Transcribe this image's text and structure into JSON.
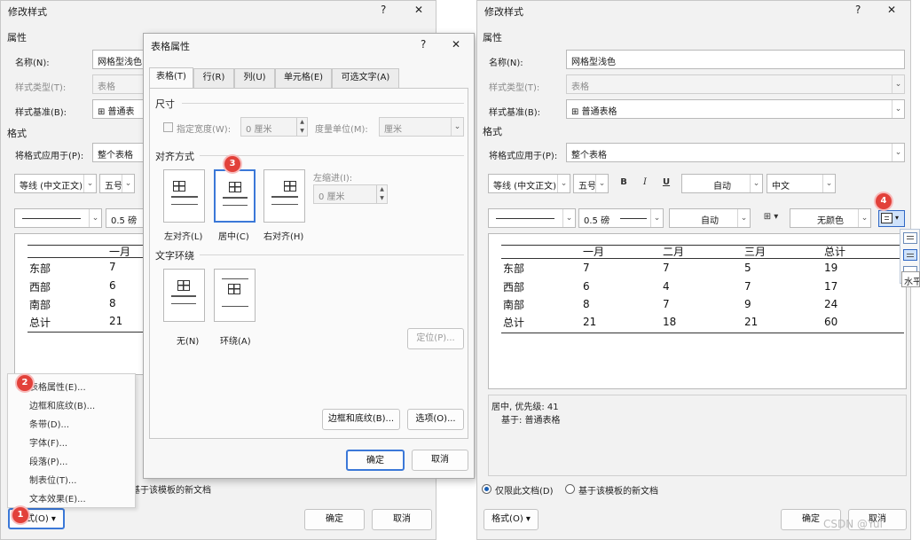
{
  "left_dialog": {
    "title": "修改样式",
    "help": "?",
    "close": "✕",
    "attributes_heading": "属性",
    "name_label": "名称(N):",
    "name_value": "网格型浅色",
    "type_label": "样式类型(T):",
    "type_value": "表格",
    "base_label": "样式基准(B):",
    "base_value": "⊞ 普通表",
    "format_heading": "格式",
    "apply_label": "将格式应用于(P):",
    "apply_value": "整个表格",
    "font_value": "等线 (中文正文)",
    "size_value": "五号",
    "border_size": "0.5 磅",
    "preview": {
      "header": "一月",
      "rows": [
        [
          "东部",
          "7"
        ],
        [
          "西部",
          "6"
        ],
        [
          "南部",
          "8"
        ],
        [
          "总计",
          "21"
        ]
      ]
    },
    "radio_text": "基于该模板的新文档",
    "format_button": "格式(O) ▾",
    "ok_button": "确定",
    "cancel_button": "取消"
  },
  "format_menu": {
    "items": [
      "表格属性(E)...",
      "边框和底纹(B)...",
      "条带(D)...",
      "字体(F)...",
      "段落(P)...",
      "制表位(T)...",
      "文本效果(E)..."
    ]
  },
  "badges": [
    "1",
    "2",
    "3",
    "4"
  ],
  "table_props": {
    "title": "表格属性",
    "help": "?",
    "close": "✕",
    "tabs": [
      "表格(T)",
      "行(R)",
      "列(U)",
      "单元格(E)",
      "可选文字(A)"
    ],
    "size_heading": "尺寸",
    "width_label": "指定宽度(W):",
    "width_value": "0 厘米",
    "unit_label": "度量单位(M):",
    "unit_value": "厘米",
    "align_heading": "对齐方式",
    "align_options": [
      "左对齐(L)",
      "居中(C)",
      "右对齐(H)"
    ],
    "indent_label": "左缩进(I):",
    "indent_value": "0 厘米",
    "wrap_heading": "文字环绕",
    "wrap_options": [
      "无(N)",
      "环绕(A)"
    ],
    "position_button": "定位(P)...",
    "borders_button": "边框和底纹(B)...",
    "options_button": "选项(O)...",
    "ok_button": "确定",
    "cancel_button": "取消"
  },
  "right_dialog": {
    "title": "修改样式",
    "help": "?",
    "close": "✕",
    "attributes_heading": "属性",
    "name_label": "名称(N):",
    "name_value": "网格型浅色",
    "type_label": "样式类型(T):",
    "type_value": "表格",
    "base_label": "样式基准(B):",
    "base_value": "⊞ 普通表格",
    "format_heading": "格式",
    "apply_label": "将格式应用于(P):",
    "apply_value": "整个表格",
    "font_value": "等线 (中文正文)",
    "size_value": "五号",
    "bold": "B",
    "italic": "I",
    "underline": "U",
    "color_value": "自动",
    "lang_value": "中文",
    "border_size": "0.5 磅",
    "border_color": "自动",
    "shading": "无颜色",
    "preview": {
      "headers": [
        "一月",
        "二月",
        "三月",
        "总计"
      ],
      "rows": [
        [
          "东部",
          "7",
          "7",
          "5",
          "19"
        ],
        [
          "西部",
          "6",
          "4",
          "7",
          "17"
        ],
        [
          "南部",
          "8",
          "7",
          "9",
          "24"
        ],
        [
          "总计",
          "21",
          "18",
          "21",
          "60"
        ]
      ]
    },
    "description_line1": "居中, 优先级: 41",
    "description_line2": "基于: 普通表格",
    "radio_this_doc": "仅限此文档(D)",
    "radio_template": "基于该模板的新文档",
    "tooltip": "水平",
    "format_button": "格式(O) ▾",
    "ok_button": "确定",
    "cancel_button": "取消"
  },
  "watermark": "CSDN @Yui_"
}
